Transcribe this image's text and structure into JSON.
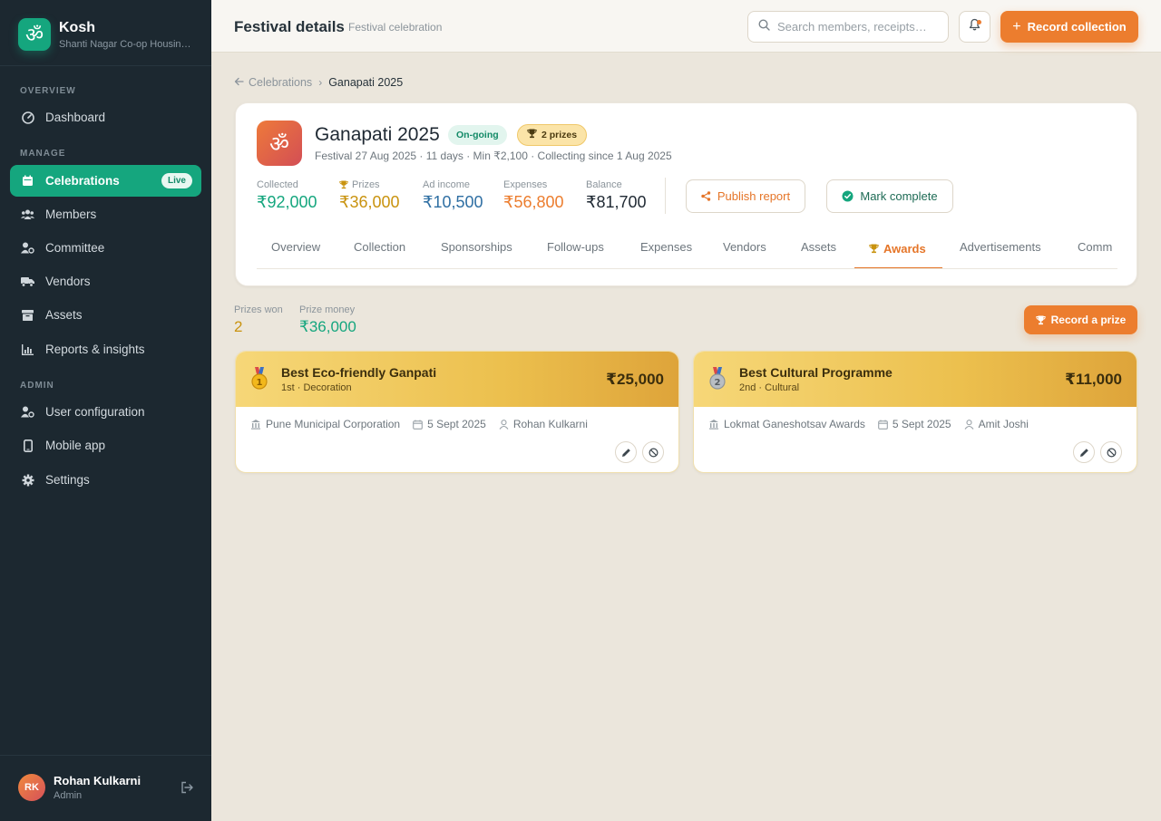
{
  "sidebar": {
    "brand_name": "Kosh",
    "brand_subtitle": "Shanti Nagar Co-op Housing Society",
    "sections": {
      "overview": "OVERVIEW",
      "manage": "MANAGE",
      "admin": "ADMIN"
    },
    "items": {
      "dashboard": "Dashboard",
      "celebrations": "Celebrations",
      "celebrations_badge": "Live",
      "members": "Members",
      "committee": "Committee",
      "vendors": "Vendors",
      "assets": "Assets",
      "reports": "Reports & insights",
      "user_config": "User configuration",
      "mobile_app": "Mobile app",
      "settings": "Settings"
    },
    "user": {
      "initials": "RK",
      "name": "Rohan Kulkarni",
      "role": "Admin"
    }
  },
  "topbar": {
    "title": "Festival details",
    "subtitle": "Festival celebration",
    "search_placeholder": "Search members, receipts…",
    "record_button": "Record collection"
  },
  "breadcrumb": {
    "parent": "Celebrations",
    "current": "Ganapati 2025"
  },
  "festival": {
    "icon_glyph": "ॐ",
    "name": "Ganapati 2025",
    "status_badge": "On-going",
    "prizes_badge": "2 prizes",
    "meta": "Festival 27 Aug 2025 · 11 days · Min ₹2,100 · Collecting since 1 Aug 2025",
    "stats": {
      "collected_label": "Collected",
      "collected_value": "₹92,000",
      "prizes_label": "Prizes",
      "prizes_value": "₹36,000",
      "ad_income_label": "Ad income",
      "ad_income_value": "₹10,500",
      "expenses_label": "Expenses",
      "expenses_value": "₹56,800",
      "balance_label": "Balance",
      "balance_value": "₹81,700"
    },
    "publish_button": "Publish report",
    "complete_button": "Mark complete",
    "tabs": {
      "overview": "Overview",
      "collection": "Collection",
      "sponsorships": "Sponsorships",
      "followups": "Follow-ups",
      "expenses": "Expenses",
      "vendors": "Vendors",
      "assets": "Assets",
      "awards": "Awards",
      "advertisements": "Advertisements",
      "comm": "Comm"
    }
  },
  "awards_summary": {
    "prizes_won_label": "Prizes won",
    "prizes_won_value": "2",
    "prize_money_label": "Prize money",
    "prize_money_value": "₹36,000",
    "record_prize_button": "Record a prize"
  },
  "awards": [
    {
      "title": "Best Eco-friendly Ganpati",
      "subtitle": "1st · Decoration",
      "amount": "₹25,000",
      "organizer": "Pune Municipal Corporation",
      "date": "5 Sept 2025",
      "recorded_by": "Rohan Kulkarni",
      "medal": "gold-medal-icon"
    },
    {
      "title": "Best Cultural Programme",
      "subtitle": "2nd · Cultural",
      "amount": "₹11,000",
      "organizer": "Lokmat Ganeshotsav Awards",
      "date": "5 Sept 2025",
      "recorded_by": "Amit Joshi",
      "medal": "silver-medal-icon"
    }
  ],
  "colors": {
    "accent_green": "#15a67e",
    "accent_orange": "#ec7d2e",
    "sidebar_bg": "#1c2830",
    "page_bg": "#ebe6dc",
    "collected": "#15a67e",
    "prizes": "#c9930f",
    "ad_income": "#2f6fa3",
    "expenses": "#ec7d2e",
    "balance": "#1f2933"
  }
}
